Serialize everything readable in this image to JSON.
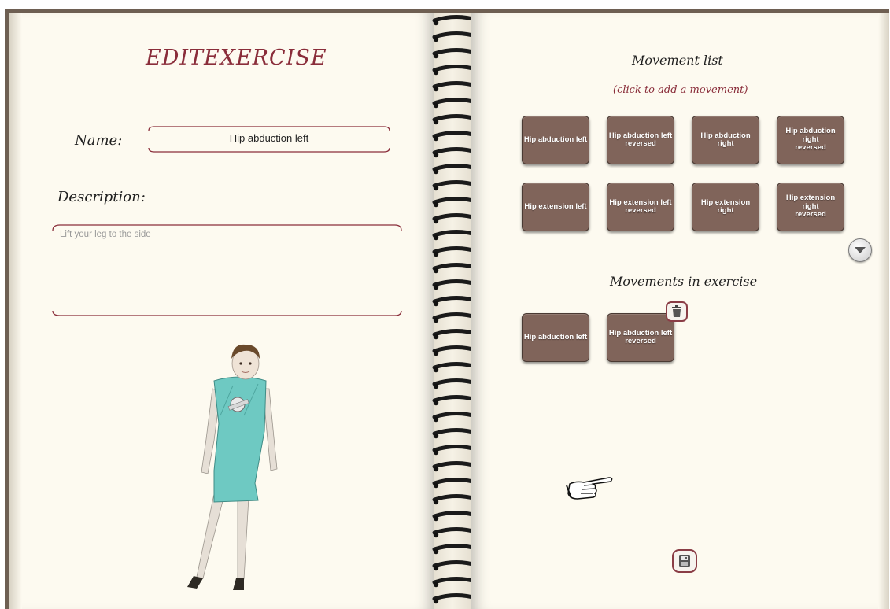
{
  "left_page": {
    "title": "EDITEXERCISE",
    "name_label": "Name:",
    "name_value": "Hip abduction left",
    "description_label": "Description:",
    "description_value": "Lift your leg to the side"
  },
  "right_page": {
    "movement_list_title": "Movement list",
    "movement_list_hint": "(click to add a movement)",
    "movement_list": [
      "Hip abduction left",
      "Hip abduction left\nreversed",
      "Hip abduction right",
      "Hip abduction right\nreversed",
      "Hip extension left",
      "Hip extension left\nreversed",
      "Hip extension right",
      "Hip extension right\nreversed"
    ],
    "exercise_title": "Movements in exercise",
    "exercise_movements": [
      "Hip abduction left",
      "Hip abduction left\nreversed"
    ]
  },
  "icons": {
    "scroll_down": "chevron-down-icon",
    "delete": "trash-icon",
    "save": "floppy-disk-icon",
    "pointer": "pointing-hand-icon"
  },
  "colors": {
    "accent": "#8a2d3a",
    "tile": "#80645a",
    "paper": "#fdfaf0"
  }
}
